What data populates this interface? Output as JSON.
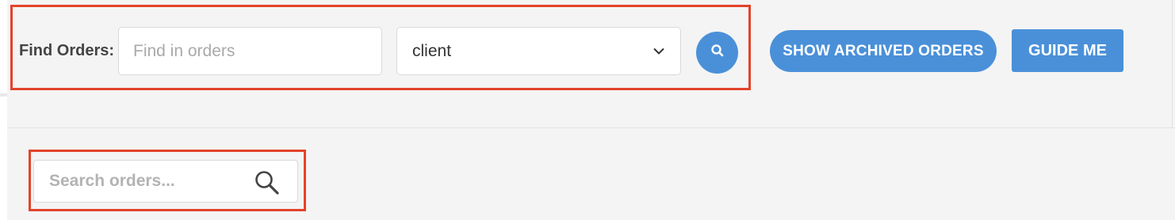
{
  "toolbar": {
    "find_label": "Find Orders:",
    "find_placeholder": "Find in orders",
    "field_selected": "client",
    "archived_label": "SHOW ARCHIVED ORDERS",
    "guide_label": "GUIDE ME"
  },
  "list_search": {
    "placeholder": "Search orders..."
  },
  "icons": {
    "search_button": "search-icon",
    "dropdown": "chevron-down-icon",
    "list_search": "magnifier-icon"
  },
  "colors": {
    "accent": "#4a90d9",
    "highlight": "#e3432a",
    "background": "#f4f4f4"
  }
}
